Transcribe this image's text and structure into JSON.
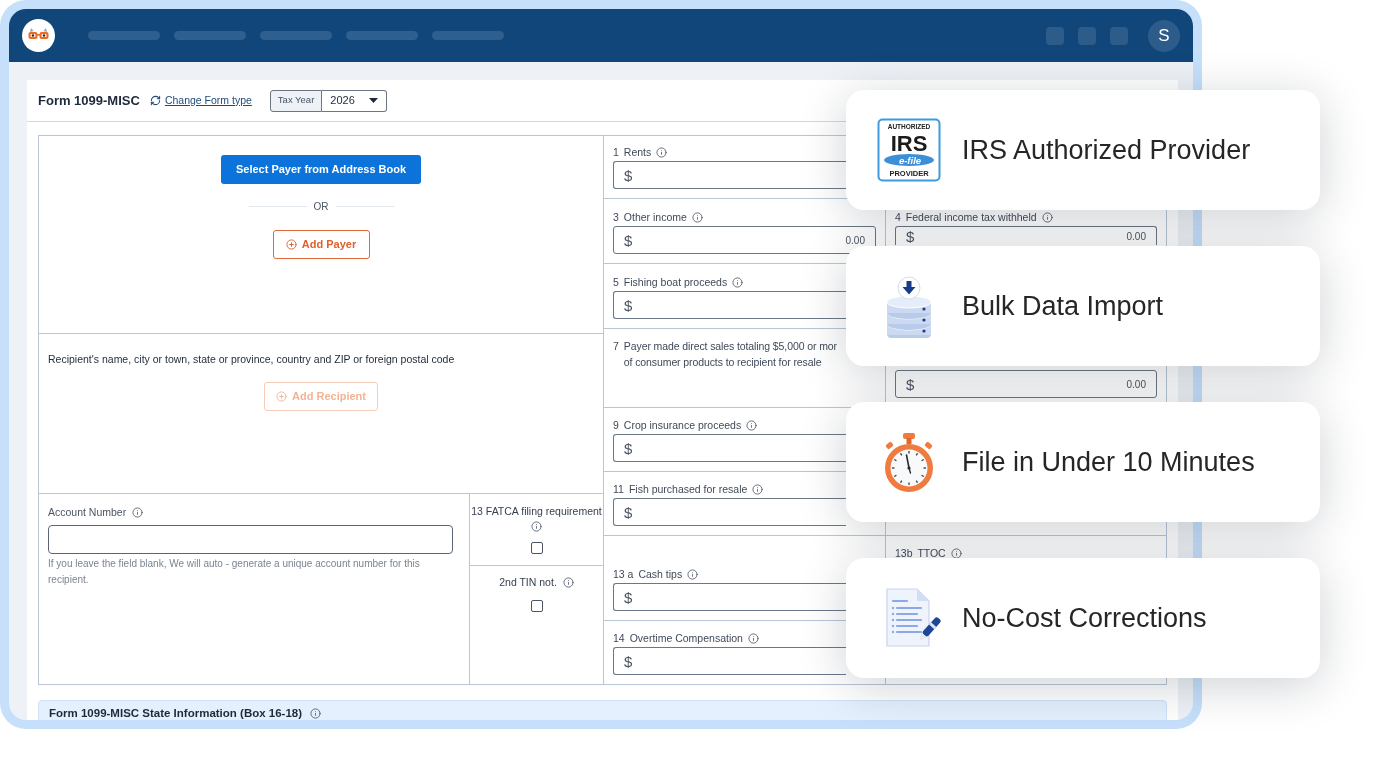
{
  "app_bar": {
    "avatar_initial": "S"
  },
  "form": {
    "title": "Form 1099-MISC",
    "change_type_link": "Change Form type",
    "tax_year": {
      "label": "Tax Year",
      "value": "2026"
    },
    "payer": {
      "address_book_button": "Select Payer from Address Book",
      "separator": "OR",
      "add_button": {
        "label": "Add Payer",
        "disabled": false
      }
    },
    "recipient": {
      "label": "Recipient's name, city or town, state or province, country and ZIP or foreign postal code",
      "add_button": {
        "label": "Add Recipient",
        "disabled": true
      }
    },
    "account_number": {
      "label": "Account Number",
      "hint": "If you leave the field blank, We will auto - generate a unique account number for this recipient."
    },
    "checkboxes": [
      {
        "label": "13 FATCA filing requirement",
        "checked": false
      },
      {
        "label": "2nd TIN not.",
        "checked": false
      }
    ],
    "boxes": [
      {
        "kind": "amount",
        "number": "1",
        "label": "Rents",
        "info": true,
        "currency": "$"
      },
      {
        "kind": "amount",
        "number": "3",
        "label": "Other income",
        "info": true,
        "currency": "$",
        "value": "0.00"
      },
      {
        "kind": "amount",
        "number": "5",
        "label": "Fishing boat proceeds",
        "info": true,
        "currency": "$"
      },
      {
        "kind": "statement",
        "number": "7",
        "label_lines": [
          "Payer made direct sales totaling $5,000 or mor",
          "of consumer products to recipient for resale"
        ],
        "info": false
      },
      {
        "kind": "amount",
        "number": "9",
        "label": "Crop insurance proceeds",
        "info": true,
        "currency": "$"
      },
      {
        "kind": "amount",
        "number": "11",
        "label": "Fish purchased for resale",
        "info": true,
        "currency": "$"
      },
      {
        "kind": "amount",
        "number": "13 a",
        "label": "Cash tips",
        "info": true,
        "currency": "$"
      },
      {
        "kind": "amount",
        "number": "14",
        "label": "Overtime Compensation",
        "info": true,
        "currency": "$"
      }
    ],
    "right_boxes": [
      {
        "kind": "amount",
        "number": "4",
        "label": "Federal income tax withheld",
        "info": true,
        "currency": "$",
        "value": "0.00"
      },
      {
        "kind": "amount",
        "currency": "$",
        "value": "0.00"
      },
      {
        "kind": "statement",
        "number": "13b",
        "label_lines": [
          "TTOC"
        ],
        "info": true
      }
    ],
    "state_section": {
      "title": "Form 1099-MISC State Information (Box 16-18)"
    }
  },
  "features": [
    {
      "kind": "irs-logo",
      "title": "IRS Authorized Provider",
      "logo": {
        "top": "AUTHORIZED",
        "main": "IRS",
        "band": "e-file",
        "bottom": "PROVIDER"
      }
    },
    {
      "kind": "database",
      "title": "Bulk Data Import"
    },
    {
      "kind": "stopwatch",
      "title": "File in Under 10 Minutes"
    },
    {
      "kind": "document",
      "title": "No-Cost Corrections"
    }
  ]
}
